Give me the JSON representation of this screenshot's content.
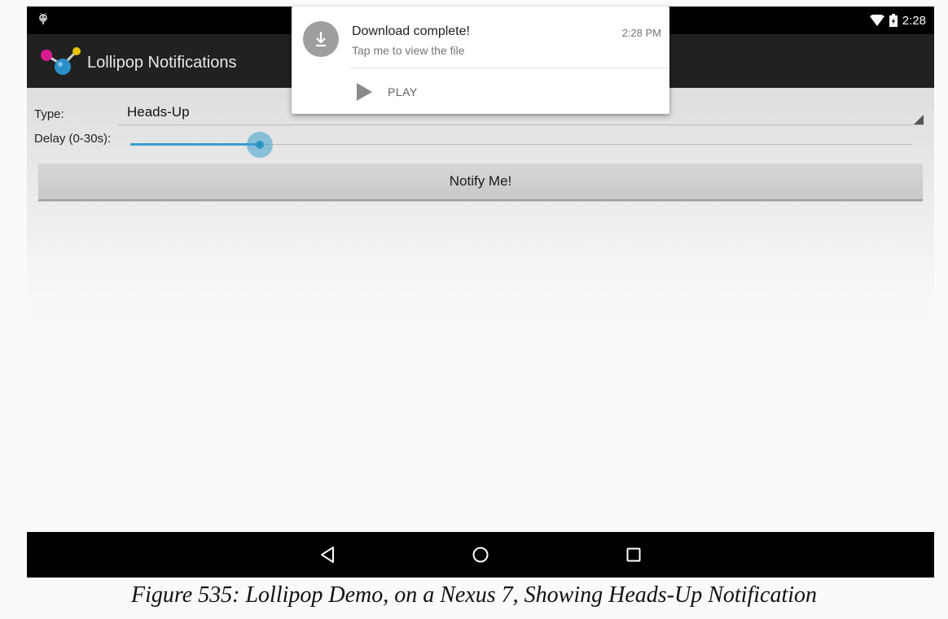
{
  "status_bar": {
    "time": "2:28",
    "wifi_icon": "wifi-icon",
    "battery_icon": "battery-icon",
    "debug_icon": "android-icon"
  },
  "app_bar": {
    "title": "Lollipop Notifications",
    "logo_icon": "molecule-logo-icon"
  },
  "form": {
    "type_label": "Type:",
    "type_value": "Heads-Up",
    "delay_label": "Delay (0-30s):",
    "delay_fraction": 0.166,
    "button_label": "Notify Me!"
  },
  "notification": {
    "icon": "download-icon",
    "title": "Download complete!",
    "time": "2:28 PM",
    "text": "Tap me to view the file",
    "action_icon": "play-icon",
    "action_label": "PLAY"
  },
  "nav_bar": {
    "back_icon": "back-icon",
    "home_icon": "home-icon",
    "recents_icon": "recents-icon"
  },
  "caption": "Figure 535: Lollipop Demo, on a Nexus 7, Showing Heads-Up Notification",
  "colors": {
    "accent": "#3a9fce",
    "status_bar": "#000000",
    "app_bar": "#212121"
  }
}
